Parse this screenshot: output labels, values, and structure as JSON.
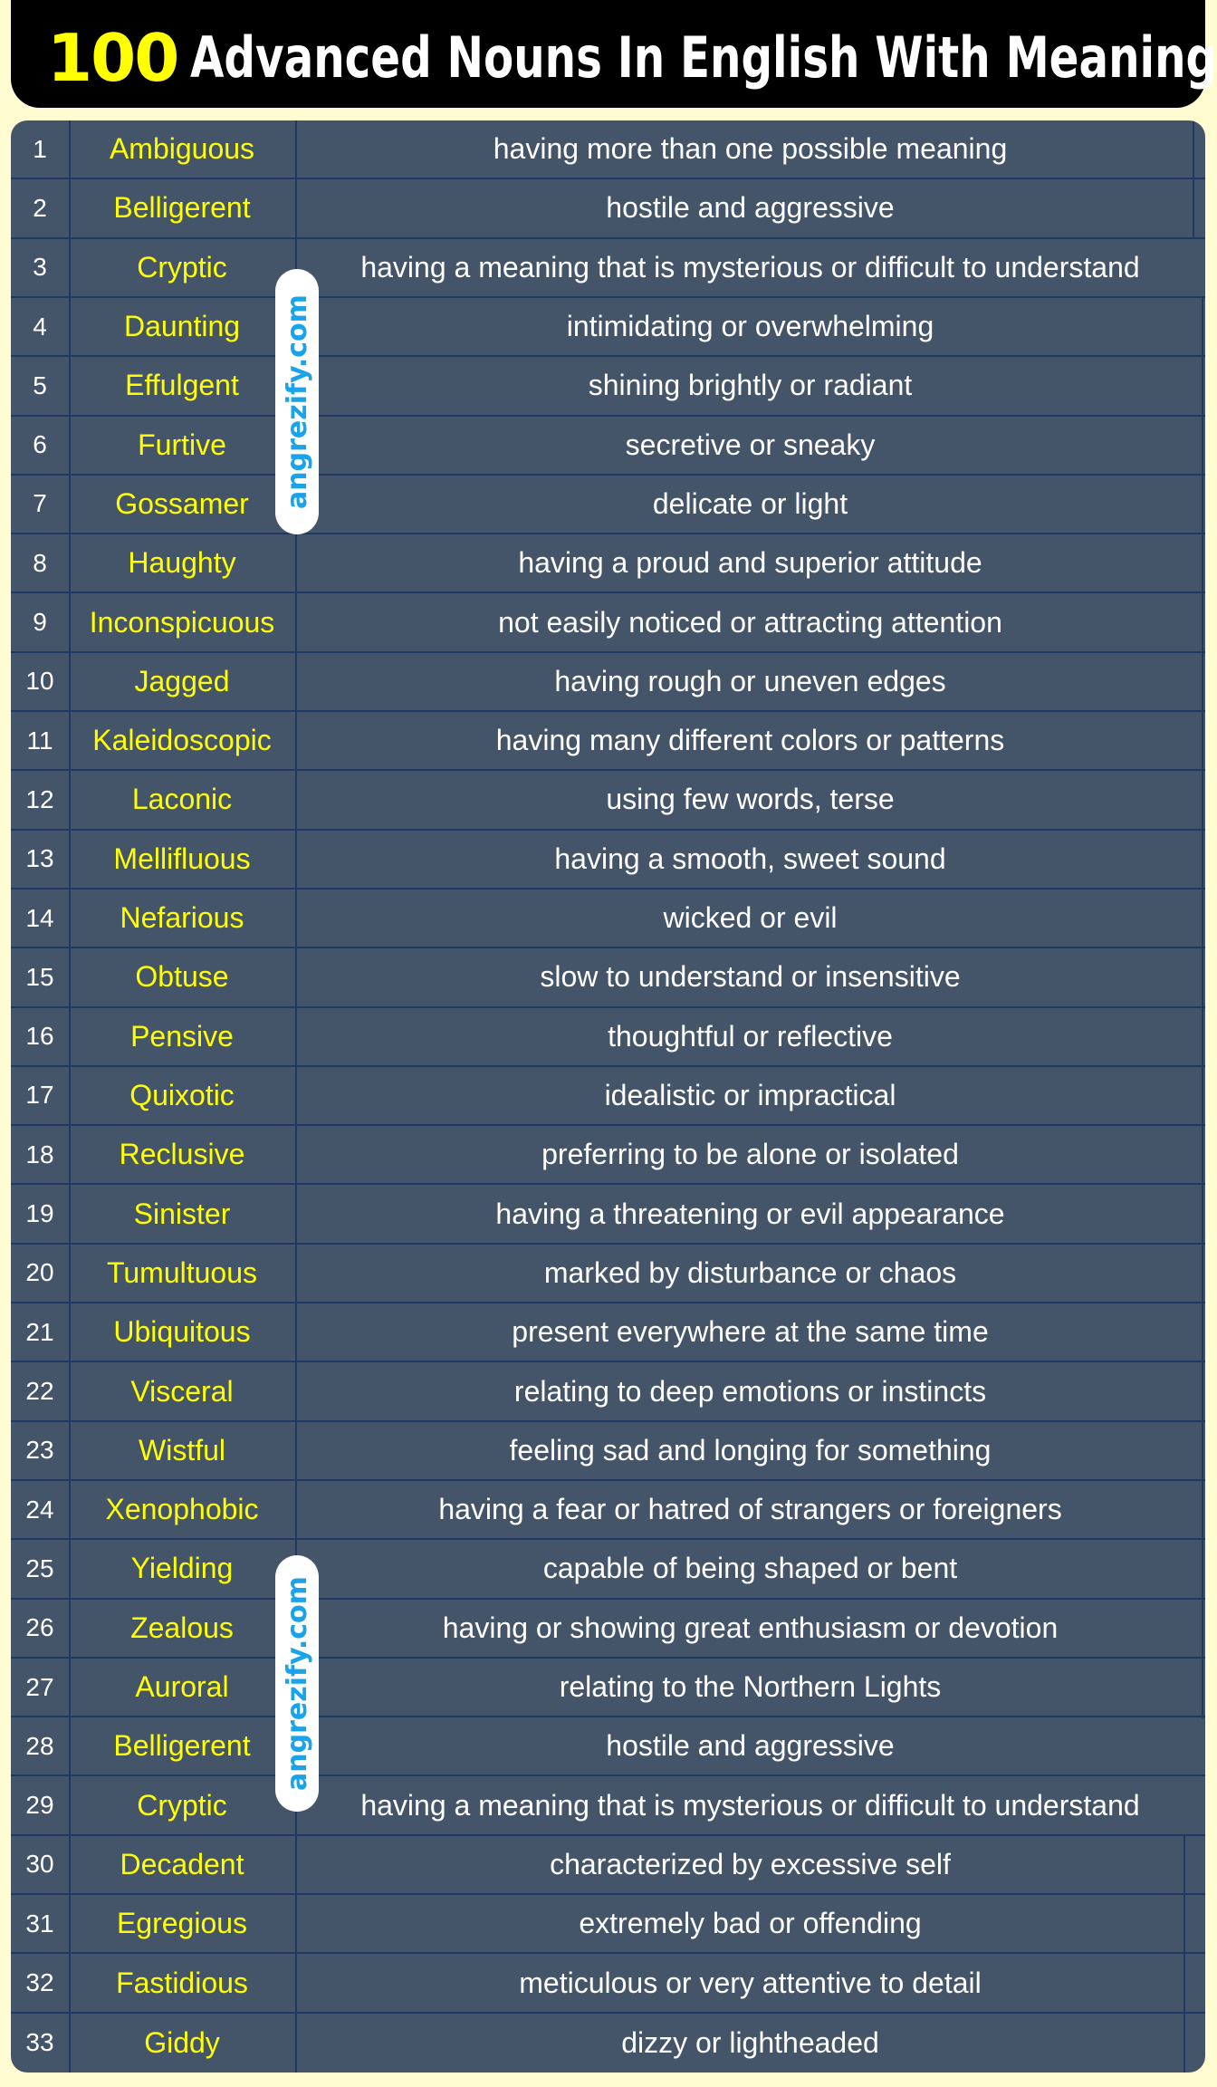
{
  "title": {
    "number": "100",
    "text": "Advanced Nouns In English With Meaning"
  },
  "watermark": "angrezify.com",
  "colors": {
    "background": "#fffcd2",
    "title_bar": "#000000",
    "title_number": "#ffff00",
    "table_bg": "#455569",
    "grid_line": "#1f3864",
    "word": "#ffff00",
    "meaning": "#ffffff",
    "watermark": "#1aa3e8"
  },
  "rows": [
    {
      "num": "1",
      "word": "Ambiguous",
      "meaning": "having more than one possible meaning"
    },
    {
      "num": "2",
      "word": "Belligerent",
      "meaning": "hostile and aggressive"
    },
    {
      "num": "3",
      "word": "Cryptic",
      "meaning": "having a meaning that is mysterious or difficult to understand"
    },
    {
      "num": "4",
      "word": "Daunting",
      "meaning": "intimidating or overwhelming"
    },
    {
      "num": "5",
      "word": "Effulgent",
      "meaning": "shining brightly or radiant"
    },
    {
      "num": "6",
      "word": "Furtive",
      "meaning": "secretive or sneaky"
    },
    {
      "num": "7",
      "word": "Gossamer",
      "meaning": "delicate or light"
    },
    {
      "num": "8",
      "word": "Haughty",
      "meaning": "having a proud and superior attitude"
    },
    {
      "num": "9",
      "word": "Inconspicuous",
      "meaning": "not easily noticed or attracting attention"
    },
    {
      "num": "10",
      "word": "Jagged",
      "meaning": "having rough or uneven edges"
    },
    {
      "num": "11",
      "word": "Kaleidoscopic",
      "meaning": "having many different colors or patterns"
    },
    {
      "num": "12",
      "word": "Laconic",
      "meaning": "using few words, terse"
    },
    {
      "num": "13",
      "word": "Mellifluous",
      "meaning": "having a smooth, sweet sound"
    },
    {
      "num": "14",
      "word": "Nefarious",
      "meaning": "wicked or evil"
    },
    {
      "num": "15",
      "word": "Obtuse",
      "meaning": "slow to understand or insensitive"
    },
    {
      "num": "16",
      "word": "Pensive",
      "meaning": "thoughtful or reflective"
    },
    {
      "num": "17",
      "word": "Quixotic",
      "meaning": "idealistic or impractical"
    },
    {
      "num": "18",
      "word": "Reclusive",
      "meaning": "preferring to be alone or isolated"
    },
    {
      "num": "19",
      "word": "Sinister",
      "meaning": "having a threatening or evil appearance"
    },
    {
      "num": "20",
      "word": "Tumultuous",
      "meaning": "marked by disturbance or chaos"
    },
    {
      "num": "21",
      "word": "Ubiquitous",
      "meaning": "present everywhere at the same time"
    },
    {
      "num": "22",
      "word": "Visceral",
      "meaning": "relating to deep emotions or instincts"
    },
    {
      "num": "23",
      "word": "Wistful",
      "meaning": "feeling sad and longing for something"
    },
    {
      "num": "24",
      "word": "Xenophobic",
      "meaning": "having a fear or hatred of strangers or foreigners"
    },
    {
      "num": "25",
      "word": "Yielding",
      "meaning": "capable of being shaped or bent"
    },
    {
      "num": "26",
      "word": "Zealous",
      "meaning": "having or showing great enthusiasm or devotion"
    },
    {
      "num": "27",
      "word": "Auroral",
      "meaning": "relating to the Northern Lights"
    },
    {
      "num": "28",
      "word": "Belligerent",
      "meaning": "hostile and aggressive"
    },
    {
      "num": "29",
      "word": "Cryptic",
      "meaning": "having a meaning that is mysterious or difficult to understand"
    },
    {
      "num": "30",
      "word": "Decadent",
      "meaning": "characterized by excessive self"
    },
    {
      "num": "31",
      "word": "Egregious",
      "meaning": "extremely bad or offending"
    },
    {
      "num": "32",
      "word": "Fastidious",
      "meaning": "meticulous or very attentive to detail"
    },
    {
      "num": "33",
      "word": "Giddy",
      "meaning": "dizzy or lightheaded"
    }
  ]
}
